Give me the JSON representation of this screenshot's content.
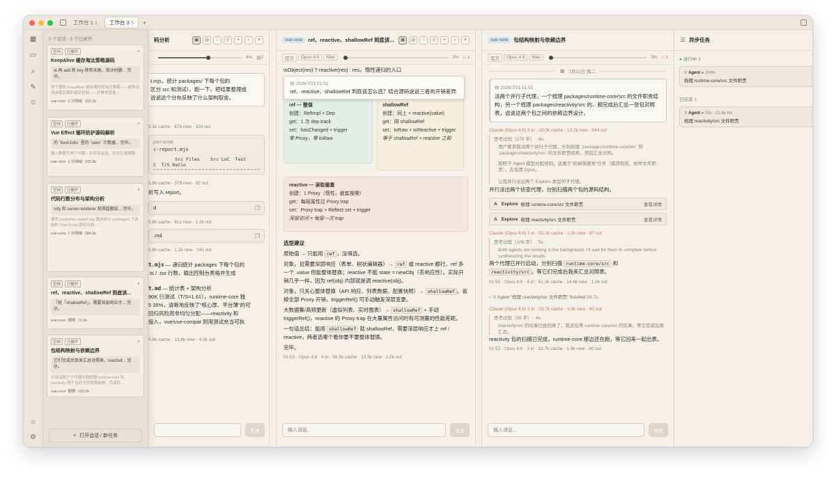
{
  "titlebar": {
    "tabs": [
      {
        "label": "工作台 1",
        "count": "1"
      },
      {
        "label": "工作台 3",
        "count": "5"
      }
    ],
    "add": "+"
  },
  "drawer": {
    "header": "5 个会话 · 5 个已展开",
    "open_button": "打开会话 / 新任务",
    "cards": [
      {
        "chip_kong": "空闲",
        "chip_open": "已展开",
        "title": "KeepAlive 缓存淘汰策略源码",
        "preview": "te 再 add 新 key 移到末尾。淘汰时删... 完毕。",
        "desc": "两个源码 KeepAlive 缓存满时的淘汰策略——被移动到末尾后面的缓存机制——并要求查看...",
        "project": "vue-core",
        "time": "2 分钟前",
        "size": "203.3k"
      },
      {
        "chip_kong": "空闲",
        "chip_open": "已展开",
        "title": "Vue Effect 循环防护源码解析",
        "preview": "的 `flushJobs` 里的 `seen` 计数器... 完毕。",
        "desc": "输入数据为单个问题，针对该会话，无法生成摘要。",
        "project": "vue-core",
        "time": "2 分钟前",
        "size": "135.8k"
      },
      {
        "chip_kong": "空闲",
        "chip_open": "已展开",
        "title": "代码行数分布与架构分析",
        "preview": "ivity 和 server-renderer 获得超额投... 完毕。",
        "desc": "编写 scripts/loc-report.mjs 脚本统计 packages/ 下各包的 TypeScript 源码与测...",
        "project": "vue-core",
        "time": "1 分钟前",
        "size": "284.5k"
      },
      {
        "chip_kong": "空闲",
        "chip_open": "已展开",
        "title": "ref、reactive、shallowRef 到底该...",
        "preview": "「就「shallowRef」，需要深层响应才... 完毕。",
        "desc": "",
        "project": "vue-core",
        "time": "刚刚",
        "size": "72.0k"
      },
      {
        "chip_kong": "空闲",
        "chip_open": "已展开",
        "title": "包结构映射与依赖边界",
        "preview": "它们完成后我来汇总对照表。reactivit... 完毕。",
        "desc": "计划派两个子代理分别梳理 runtime-core 和 reactivity 两个包的文件职责结构，完成后...",
        "project": "vue-core",
        "time": "刚刚",
        "size": "102.5k"
      }
    ]
  },
  "panel1": {
    "title": "码分析",
    "percent": "4%",
    "doc_count": "2",
    "composer_placeholder": "",
    "send": "发送",
    "lines": {
      "intro1": "t.mjs，统计 packages/ 下每个包的",
      "intro2": "区分 src 和测试），跑一下，把结果整理成",
      "intro3": "说说这个分布反映了什么架构取舍。",
      "meta1": "5.1k cache · 676 new · 104 out",
      "script_label": "port script",
      "script_name": "c-report.mjs",
      "table_header": "        Src Files    Src LoC  Test",
      "table_header2": "C  T/S Ratio",
      "meta2": "5.8k cache · 378 new · 92 out",
      "write": "析写入 report。",
      "file1": "d",
      "meta3": "5.8k cache · 612 new · 1.2k out",
      "file2": ".md",
      "meta4": "5.8k cache · 1.2k new · 241 out",
      "s1a": "t.mjs",
      "s1b": " — 递归统计 packages 下每个包的",
      "s1c": ".ts / .tsx 行数，输出控制台表格并生成",
      "s2a": "t.md",
      "s2b": " — 统计表 + 架构分析",
      "p1": "90K 行测试（T/S=1.61），runtime-core 独",
      "p2": "5 35%，清晰地反映了\"核心厚、平台薄\"的可",
      "p3": "回归风险而非均匀分配——reactivity 和",
      "p4": "投入，vue/vue-compat 则用测试充当可执",
      "meta5": "5.6k cache · 13.6k new · 4.3k out"
    }
  },
  "panel2": {
    "tag": "vue-core",
    "title": "ref、reactive、shallowRef 到底该...",
    "sb_chips": [
      "官方",
      "Opus 4.6",
      "Max"
    ],
    "percent": "3%",
    "flag_count": "1",
    "top_code": "isObject(res) ? reactive(res) : res，惰性递归的入口",
    "user": {
      "time": "你  2026/7/21 01:51",
      "text": "ref、reactive、shallowRef 到底该怎么选？结合源码说说三者的开销差异"
    },
    "green": {
      "title": "ref — 整值",
      "rows": [
        "创建：RefImpl + Dep",
        "get：1 次 dep.track",
        "set：hasChanged + trigger"
      ],
      "note": "零 Proxy，零 toRaw"
    },
    "yellow": {
      "title": "shallowRef",
      "rows": [
        "创建：同上 + reactive(value)",
        "get：同 shallowRef",
        "set：toRaw + toReactive + trigger"
      ],
      "note": "等于 shallowRef + reactive 之和"
    },
    "pink": {
      "title": "reactive — 读取最重",
      "rows": [
        "创建：1 Proxy（惰性，嵌套按需）",
        "get：每层属性过 Proxy trap",
        "set：Proxy trap + Reflect.set + trigger"
      ],
      "note": "深层访问 = 每层一次 trap"
    },
    "section_title": "选型建议",
    "advice": [
      {
        "pre": "原始值 → 只能用 ",
        "code": "ref",
        "post": "，没得选。"
      },
      {
        "pre": "对象，且需要深层响应（表单、树状编辑器）→ ",
        "code": "ref",
        "post": " 或 reactive 都行。ref 多一个 .value 但能整体替换；reactive 不能 state = newObj（丢响应性）。实际开销几乎一样，因为 ref(obj) 内部就是调 reactive(obj)。"
      },
      {
        "pre": "对象，只关心整体替换（API 响应、列表数据、配置快照）→ ",
        "code": "shallowRef",
        "post": "。省掉全部 Proxy 开销，triggerRef() 可手动触发深层变更。"
      },
      {
        "pre": "大数据集/高频更新（虚拟列表、实时图表）→ ",
        "code": "shallowRef",
        "post": " + 手动 triggerRef()，reactive 的 Proxy trap 在大量属性访问时有可测量的性能差距。"
      },
      {
        "pre": "一句话总结：能用 ",
        "code": "shallowRef",
        "post": " 就 shallowRef，需要深层响应才上 ref / reactive，两者选哪个看你要不要整体替换。"
      }
    ],
    "done": "完毕。",
    "meta": "01:53 · Opus 4.6 · 4 in · 56.5k cache · 13.5k new · 2.0k out",
    "composer_placeholder": "输入消息...",
    "send": "发送"
  },
  "panel3": {
    "tag": "vue-core",
    "title": "包结构映射与依赖边界",
    "sb_chips": [
      "官方",
      "Opus 4.6",
      "Max"
    ],
    "percent": "3%",
    "flag_count": "1",
    "date": "7月21日 周二",
    "user": {
      "time": "你  2026/7/21 01:51",
      "text": "派两个并行子代理，一个梳理 packages/runtime-core/src 的文件职责结构，另一个梳理 packages/reactivity/src 的，都完成后汇总一张包对照表，说说这两个包之间的依赖边界设计。"
    },
    "m1": {
      "head": "Claude (Opus 4.6)  3 in · 19.0k cache · 13.2k new · 944 out",
      "think": "思考过程（170 字） · 8s",
      "think_body1": "用户要求我派两个并行子代理，分别梳理 `packages/runtime-core/src` 和 `packages/reactivity/src` 的文件职责结构，然后汇总对照。",
      "think_body2": "按照子 Agent 模型分配规则，这属于\"机械铺查类\"任务（摸清现状、枚举文件职责），应该用 Opus。",
      "think_body3": "让我并行派出两个 Explore 类型的子代理。",
      "text": "并行派出两个侦查代理，分别扫描两个包的源码结构。",
      "agents": [
        {
          "label": "Explore",
          "desc": "梳理 runtime-core/src 文件职责",
          "action": "查看详情"
        },
        {
          "label": "Explore",
          "desc": "梳理 reactivity/src 文件职责",
          "action": "查看详情"
        }
      ]
    },
    "m2": {
      "head": "Claude (Opus 4.6)  1 in · 32.2k cache · 1.5k new · 87 out",
      "think": "思考过程（106 字） · 5s",
      "think_body": "Both agents are running in the background. I'll wait for them to complete before synthesizing the results.",
      "text1": "两个代理已并行启动，分别扫描 ",
      "code1": "runtime-core/src",
      "text2": " 和 ",
      "code2": "reactivity/src",
      "text3": "。等它们完成后我来汇总对照表。",
      "meta": "01:51 · Opus 4.6 · 4 in · 51.3k cache · 14.6k new · 1.0k out"
    },
    "finished": "Agent \"梳理 reactivity/src 文件职责\" finished",
    "finished_time": "58.7s",
    "m3": {
      "head": "Claude (Opus 4.6)  3 in · 33.7k cache · 1.8k new · 90 out",
      "think": "思考过程（59 字） · 4s",
      "think_body": "reactivity/src 的结果已经回来了，我还在等 runtime-core/src 的结果。等它完成后再汇总。",
      "text": "reactivity 包的扫描已完成，runtime-core 那边还在跑，等它回来一起出表。",
      "meta": "01:52 · Opus 4.6 · 3 in · 33.7k cache · 1.8k new · 90 out"
    },
    "composer_placeholder": "输入消息...",
    "send": "发送"
  },
  "async": {
    "title": "异步任务",
    "running_label": "进行中",
    "running_count": "1",
    "running": {
      "agent": "Agent",
      "time": "2m6s",
      "desc": "梳理 runtime-core/src 文件职责"
    },
    "done_label": "已结束",
    "done_count": "1",
    "done": {
      "agent": "Agent",
      "time": "59s · 21.4k tok",
      "desc": "梳理 reactivity/src 文件职责"
    }
  }
}
